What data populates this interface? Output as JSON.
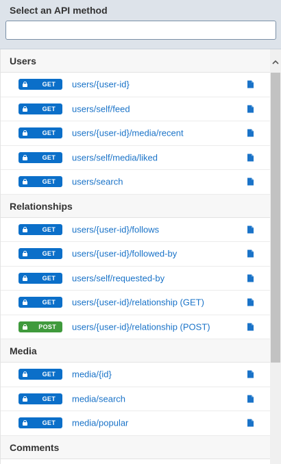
{
  "header": {
    "title": "Select an API method",
    "search_placeholder": "",
    "search_value": ""
  },
  "colors": {
    "get": "#0b6fc9",
    "post": "#3f9a3c",
    "link": "#1a73c8"
  },
  "sections": [
    {
      "title": "Users",
      "items": [
        {
          "method": "GET",
          "path": "users/{user-id}"
        },
        {
          "method": "GET",
          "path": "users/self/feed"
        },
        {
          "method": "GET",
          "path": "users/{user-id}/media/recent"
        },
        {
          "method": "GET",
          "path": "users/self/media/liked"
        },
        {
          "method": "GET",
          "path": "users/search"
        }
      ]
    },
    {
      "title": "Relationships",
      "items": [
        {
          "method": "GET",
          "path": "users/{user-id}/follows"
        },
        {
          "method": "GET",
          "path": "users/{user-id}/followed-by"
        },
        {
          "method": "GET",
          "path": "users/self/requested-by"
        },
        {
          "method": "GET",
          "path": "users/{user-id}/relationship (GET)"
        },
        {
          "method": "POST",
          "path": "users/{user-id}/relationship (POST)"
        }
      ]
    },
    {
      "title": "Media",
      "items": [
        {
          "method": "GET",
          "path": "media/{id}"
        },
        {
          "method": "GET",
          "path": "media/search"
        },
        {
          "method": "GET",
          "path": "media/popular"
        }
      ]
    },
    {
      "title": "Comments",
      "items": []
    }
  ],
  "icons": {
    "lock": "lock-icon",
    "doc": "document-icon",
    "scroll_up": "chevron-up-icon"
  }
}
